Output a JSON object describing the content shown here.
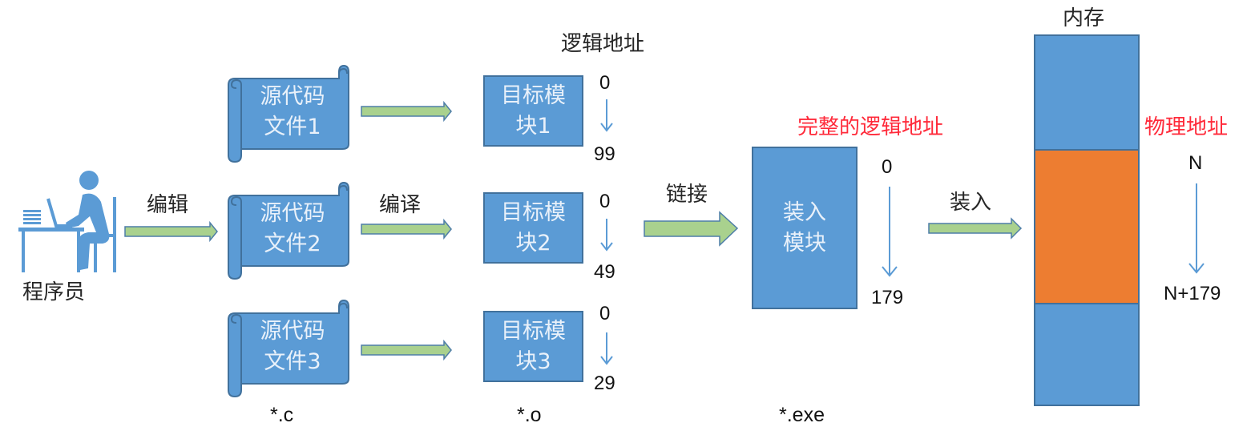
{
  "programmer": {
    "label": "程序员",
    "icon": "programmer-at-desk-icon"
  },
  "steps": {
    "edit": "编辑",
    "compile": "编译",
    "link": "链接",
    "load": "装入"
  },
  "source_files": [
    {
      "line1": "源代码",
      "line2": "文件1"
    },
    {
      "line1": "源代码",
      "line2": "文件2"
    },
    {
      "line1": "源代码",
      "line2": "文件3"
    }
  ],
  "source_ext": "*.c",
  "logical_address_title": "逻辑地址",
  "object_modules": [
    {
      "line1": "目标模",
      "line2": "块1",
      "start": "0",
      "end": "99"
    },
    {
      "line1": "目标模",
      "line2": "块2",
      "start": "0",
      "end": "49"
    },
    {
      "line1": "目标模",
      "line2": "块3",
      "start": "0",
      "end": "29"
    }
  ],
  "object_ext": "*.o",
  "load_module": {
    "line1": "装入",
    "line2": "模块",
    "title": "完整的逻辑地址",
    "start": "0",
    "end": "179",
    "ext": "*.exe"
  },
  "memory": {
    "title": "内存",
    "physical_title": "物理地址",
    "start": "N",
    "end": "N+179"
  },
  "colors": {
    "box_fill": "#5b9bd5",
    "box_border": "#41719c",
    "arrow_fill": "#a9d18e",
    "arrow_border": "#4e7ea8",
    "highlight": "#ed7d31",
    "red_text": "#ff2a3a"
  }
}
